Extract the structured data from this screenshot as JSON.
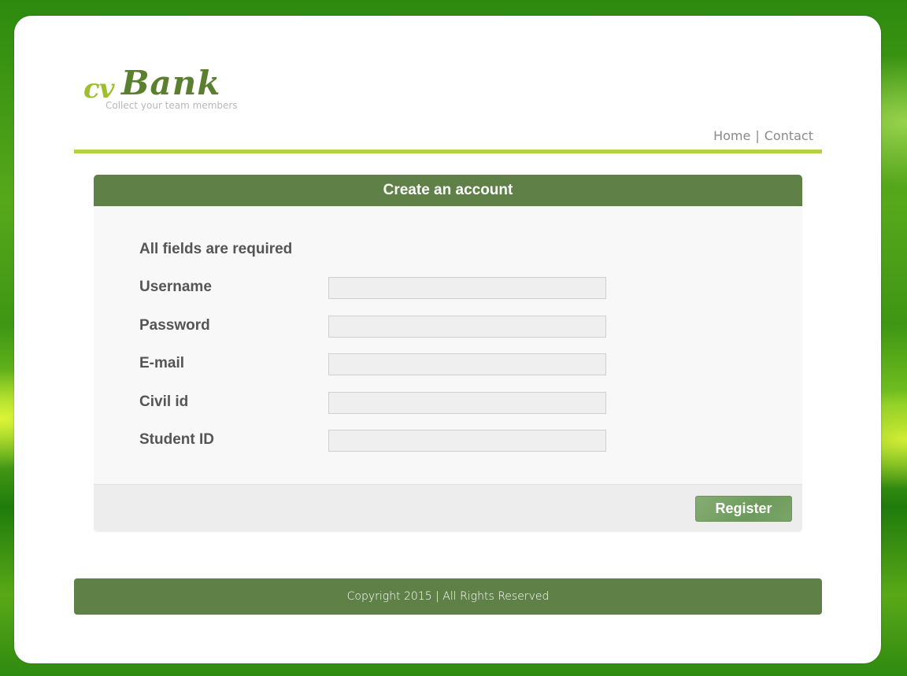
{
  "brand": {
    "logo_cv": "cv",
    "logo_bank": "Bank",
    "tagline": "Collect your team members"
  },
  "nav": {
    "home": "Home",
    "separator": "|",
    "contact": "Contact"
  },
  "form": {
    "title": "Create an account",
    "required_note": "All fields are required",
    "fields": [
      {
        "label": "Username",
        "value": "",
        "placeholder": ""
      },
      {
        "label": "Password",
        "value": "",
        "placeholder": ""
      },
      {
        "label": "E-mail",
        "value": "",
        "placeholder": ""
      },
      {
        "label": "Civil id",
        "value": "",
        "placeholder": ""
      },
      {
        "label": "Student ID",
        "value": "",
        "placeholder": ""
      }
    ],
    "submit_label": "Register"
  },
  "footer": {
    "copyright": "Copyright 2015 | All Rights Reserved"
  },
  "colors": {
    "brand_green_dark": "#5f8148",
    "brand_green_light": "#b2d23e",
    "logo_cv": "#9cbf2a",
    "logo_bank": "#5a7f2e",
    "label_text": "#555555"
  }
}
